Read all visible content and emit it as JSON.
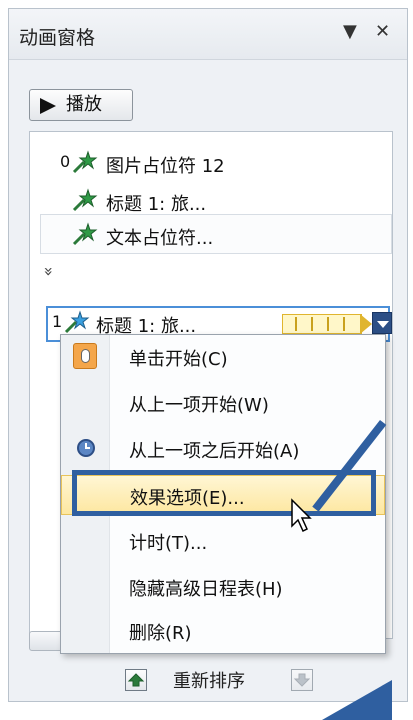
{
  "pane": {
    "title": "动画窗格",
    "dropdown_glyph": "▼",
    "close_glyph": "✕"
  },
  "play_button": {
    "label": "播放"
  },
  "animation_list": {
    "items": [
      {
        "number": "0",
        "label": "图片占位符 12"
      },
      {
        "number": "",
        "label": "标题 1: 旅..."
      },
      {
        "number": "",
        "label": "文本占位符..."
      },
      {
        "number": "1",
        "label": "标题 1: 旅..."
      }
    ],
    "expand_glyph": "»"
  },
  "context_menu": {
    "items": [
      {
        "label": "单击开始(C)",
        "icon": "mouse-click-icon"
      },
      {
        "label": "从上一项开始(W)",
        "icon": ""
      },
      {
        "label": "从上一项之后开始(A)",
        "icon": "clock-icon"
      },
      {
        "label": "效果选项(E)...",
        "icon": "",
        "highlighted": true
      },
      {
        "label": "计时(T)...",
        "icon": ""
      },
      {
        "label": "隐藏高级日程表(H)",
        "icon": ""
      },
      {
        "label": "删除(R)",
        "icon": ""
      }
    ]
  },
  "reorder": {
    "label": "重新排序"
  },
  "colors": {
    "highlight_border": "#2f5fa0",
    "menu_hover": "#fde7a0",
    "timing_bar": "#fff7c9",
    "selection": "#4b8fd8"
  }
}
